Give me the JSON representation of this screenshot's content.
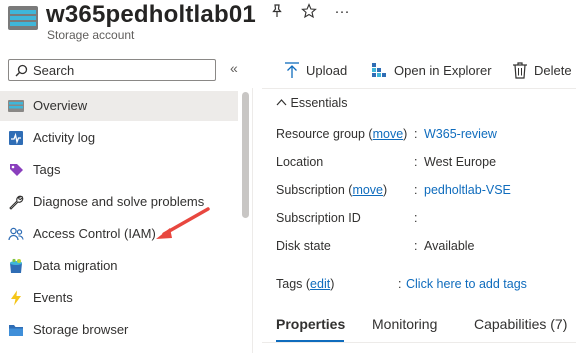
{
  "header": {
    "title": "w365pedholtlab01",
    "subtitle": "Storage account",
    "icons": [
      "storage-account-icon",
      "pin-icon",
      "favorite-star-icon",
      "more-icon"
    ],
    "more_label": "···"
  },
  "sidebar": {
    "search_placeholder": "Search",
    "collapse_glyph": "«",
    "items": [
      {
        "label": "Overview",
        "icon": "overview-icon",
        "active": true
      },
      {
        "label": "Activity log",
        "icon": "activity-log-icon"
      },
      {
        "label": "Tags",
        "icon": "tag-icon"
      },
      {
        "label": "Diagnose and solve problems",
        "icon": "wrench-icon"
      },
      {
        "label": "Access Control (IAM)",
        "icon": "people-icon"
      },
      {
        "label": "Data migration",
        "icon": "data-migration-icon"
      },
      {
        "label": "Events",
        "icon": "lightning-icon"
      },
      {
        "label": "Storage browser",
        "icon": "folder-icon"
      }
    ]
  },
  "toolbar": {
    "upload": "Upload",
    "open_in_explorer": "Open in Explorer",
    "delete": "Delete"
  },
  "essentials": {
    "toggle": "Essentials",
    "resource_group_label": "Resource group",
    "resource_group_move": "move",
    "resource_group_value": "W365-review",
    "location_label": "Location",
    "location_value": "West Europe",
    "subscription_label": "Subscription",
    "subscription_move": "move",
    "subscription_value": "pedholtlab-VSE",
    "subscription_id_label": "Subscription ID",
    "subscription_id_value": "",
    "disk_state_label": "Disk state",
    "disk_state_value": "Available",
    "tags_label": "Tags",
    "tags_edit": "edit",
    "tags_value": "Click here to add tags"
  },
  "tabs": [
    {
      "label": "Properties",
      "active": true
    },
    {
      "label": "Monitoring"
    },
    {
      "label": "Capabilities (7)"
    }
  ],
  "colors": {
    "accent": "#0f6cbd",
    "annotation_arrow": "#e8473f",
    "nav_active_bg": "#edebe9"
  }
}
